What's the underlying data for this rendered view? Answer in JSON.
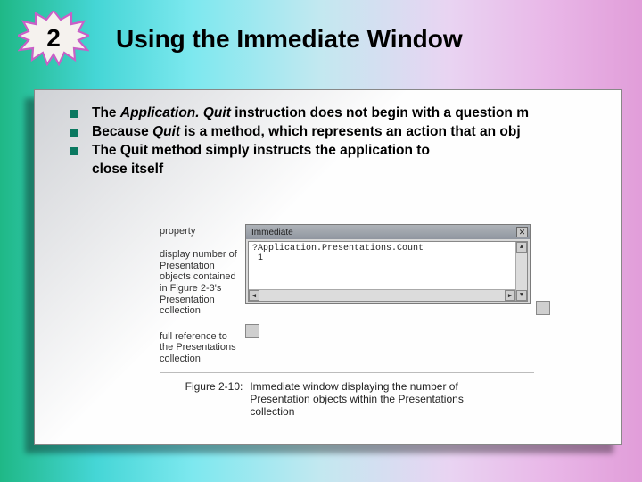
{
  "header": {
    "starburst_number": "2",
    "title": "Using the Immediate Window"
  },
  "bullets": [
    {
      "prefix": "The ",
      "em": "Application. Quit",
      "suffix": " instruction does not begin with a question m"
    },
    {
      "prefix": "Because ",
      "em": "Quit",
      "suffix": " is a method, which represents an action that an obj"
    },
    {
      "prefix": "The Quit method simply instructs the application to",
      "em": "",
      "suffix": "",
      "line2": "close itself"
    }
  ],
  "figure": {
    "labels": {
      "property": "property",
      "display": "display number of Presentation objects contained in Figure 2-3's Presentation collection",
      "fullref": "full reference to the Presentations collection"
    },
    "immediate": {
      "title": "Immediate",
      "close_glyph": "✕",
      "code": "?Application.Presentations.Count",
      "result": " 1"
    },
    "caption": {
      "figno": "Figure 2-10:",
      "text": "Immediate window displaying the number of Presentation objects within the Presentations collection"
    }
  }
}
